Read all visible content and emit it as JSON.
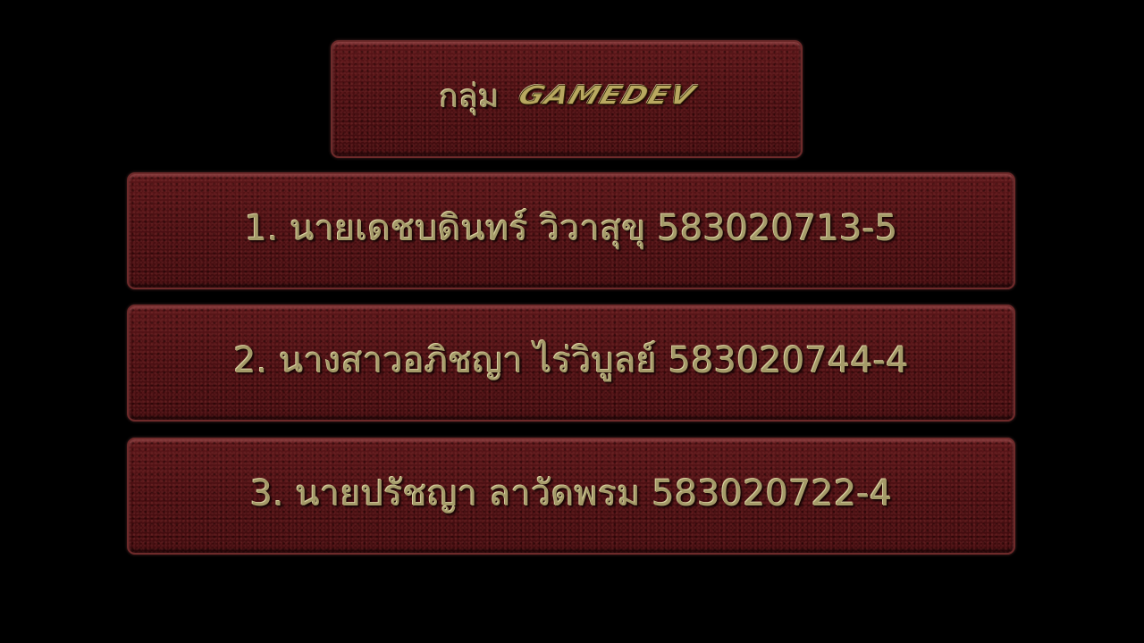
{
  "slide": {
    "background": "#000000",
    "panel_color": "#4c0e11",
    "text_color": "#a49a68"
  },
  "group": {
    "label": "กลุ่ม",
    "name": "GAMEDEV"
  },
  "members": [
    {
      "text": "1. นายเดชบดินทร์ วิวาสุขุ 583020713-5"
    },
    {
      "text": "2. นางสาวอภิชญา ไร่วิบูลย์ 583020744-4"
    },
    {
      "text": "3. นายปรัชญา ลาวัดพรม 583020722-4"
    }
  ]
}
